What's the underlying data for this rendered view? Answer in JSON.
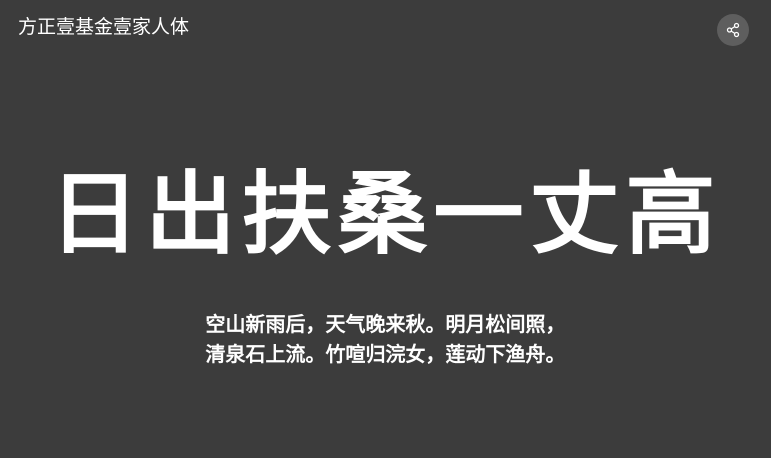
{
  "header": {
    "title": "方正壹基金壹家人体",
    "share_icon": "share-icon"
  },
  "preview": {
    "headline": "日出扶桑一丈高",
    "poem_lines": [
      "空山新雨后，天气晚来秋。明月松间照，",
      "清泉石上流。竹喧归浣女，莲动下渔舟。"
    ]
  },
  "colors": {
    "background": "#3c3c3c",
    "text": "#ffffff",
    "share_button_bg": "#5e5e5e"
  }
}
